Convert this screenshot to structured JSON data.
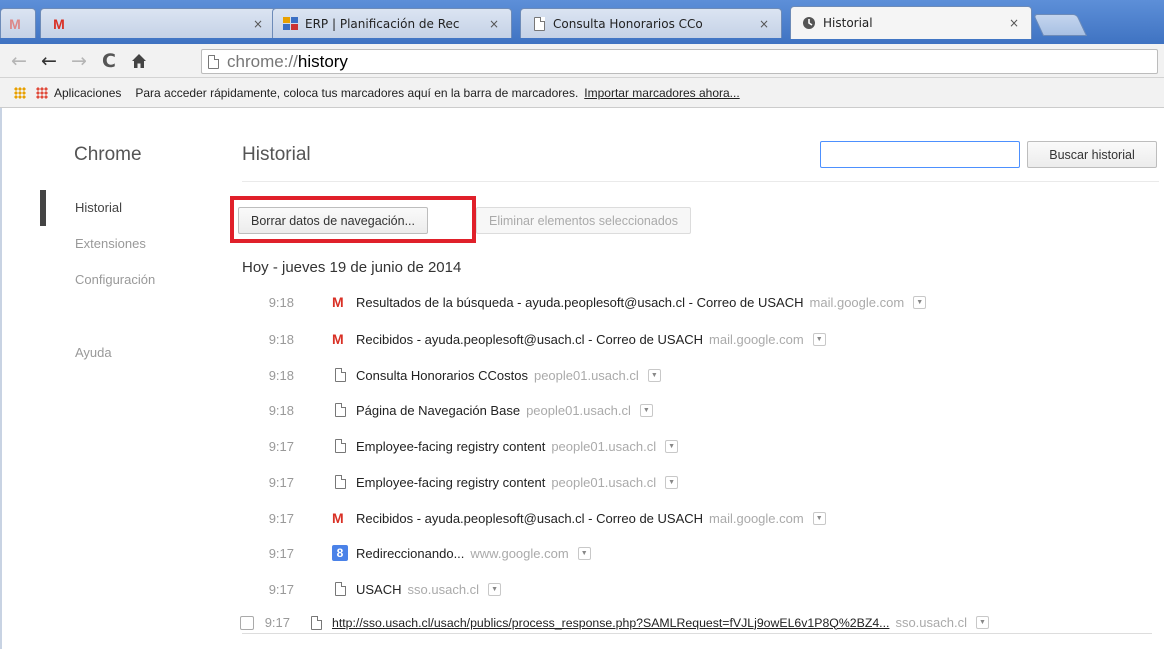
{
  "tabs": [
    {
      "title": "",
      "favicon": "gmail-icon",
      "active": false
    },
    {
      "title": "ERP | Planificación de Rec",
      "favicon": "erp-icon",
      "active": false
    },
    {
      "title": "Consulta Honorarios CCo",
      "favicon": "page-icon",
      "active": false
    },
    {
      "title": "Historial",
      "favicon": "history-icon",
      "active": true
    }
  ],
  "close_glyph": "×",
  "omnibox": {
    "scheme": "chrome://",
    "host": "history"
  },
  "bookmarks": {
    "apps": "Aplicaciones",
    "hint": "Para acceder rápidamente, coloca tus marcadores aquí en la barra de marcadores.",
    "import_link": "Importar marcadores ahora..."
  },
  "sidebar": {
    "title": "Chrome",
    "items": [
      {
        "label": "Historial"
      },
      {
        "label": "Extensiones"
      },
      {
        "label": "Configuración"
      },
      {
        "label": "Ayuda"
      }
    ]
  },
  "main": {
    "title": "Historial",
    "search_placeholder": "",
    "search_button": "Buscar historial",
    "clear_button": "Borrar datos de navegación...",
    "delete_button": "Eliminar elementos seleccionados",
    "day_header": "Hoy - jueves 19 de junio de 2014"
  },
  "entries": [
    {
      "time": "9:18",
      "icon": "gmail-icon",
      "title": "Resultados de la búsqueda - ayuda.peoplesoft@usach.cl - Correo de USACH",
      "domain": "mail.google.com"
    },
    {
      "time": "9:18",
      "icon": "gmail-icon",
      "title": "Recibidos - ayuda.peoplesoft@usach.cl - Correo de USACH",
      "domain": "mail.google.com"
    },
    {
      "time": "9:18",
      "icon": "page-icon",
      "title": "Consulta Honorarios CCostos",
      "domain": "people01.usach.cl"
    },
    {
      "time": "9:18",
      "icon": "page-icon",
      "title": "Página de Navegación Base",
      "domain": "people01.usach.cl"
    },
    {
      "time": "9:17",
      "icon": "page-icon",
      "title": "Employee-facing registry content",
      "domain": "people01.usach.cl"
    },
    {
      "time": "9:17",
      "icon": "page-icon",
      "title": "Employee-facing registry content",
      "domain": "people01.usach.cl"
    },
    {
      "time": "9:17",
      "icon": "gmail-icon",
      "title": "Recibidos - ayuda.peoplesoft@usach.cl - Correo de USACH",
      "domain": "mail.google.com"
    },
    {
      "time": "9:17",
      "icon": "google-icon",
      "title": "Redireccionando...",
      "domain": "www.google.com"
    },
    {
      "time": "9:17",
      "icon": "page-icon",
      "title": "USACH",
      "domain": "sso.usach.cl"
    },
    {
      "time": "9:17",
      "icon": "page-icon",
      "title": "http://sso.usach.cl/usach/publics/process_response.php?SAMLRequest=fVJLj9owEL6v1P8Q%2BZ4...",
      "domain": "sso.usach.cl"
    }
  ]
}
